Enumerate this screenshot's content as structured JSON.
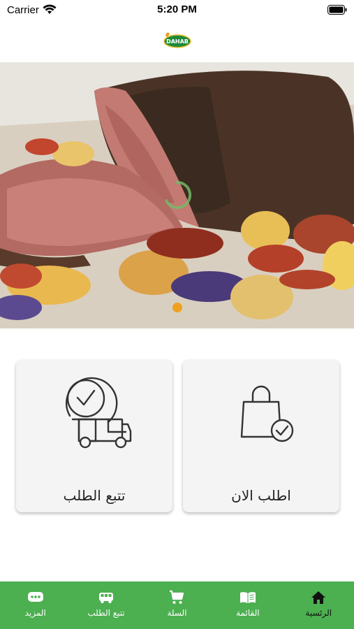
{
  "status_bar": {
    "carrier": "Carrier",
    "time": "5:20 PM"
  },
  "header": {
    "logo_text": "DAHAB"
  },
  "banner": {
    "slides_count": 1,
    "active_slide": 1
  },
  "cards": {
    "order_now": {
      "label": "اطلب الان",
      "icon": "shopping-bag-check-icon"
    },
    "track_order": {
      "label": "تتبع الطلب",
      "icon": "delivery-truck-clock-icon"
    }
  },
  "tabs": [
    {
      "label": "الرئسية",
      "icon": "home-icon",
      "active": true
    },
    {
      "label": "القائمة",
      "icon": "book-icon",
      "active": false
    },
    {
      "label": "السلة",
      "icon": "cart-icon",
      "active": false
    },
    {
      "label": "تتبع الطلب",
      "icon": "truck-icon",
      "active": false
    },
    {
      "label": "المزيد",
      "icon": "more-icon",
      "active": false
    }
  ],
  "colors": {
    "tabbar": "#4caf50",
    "active_tab_text": "#111111",
    "tab_text": "#ffffff",
    "dot": "#f0a020",
    "card_bg": "#f4f4f4"
  }
}
